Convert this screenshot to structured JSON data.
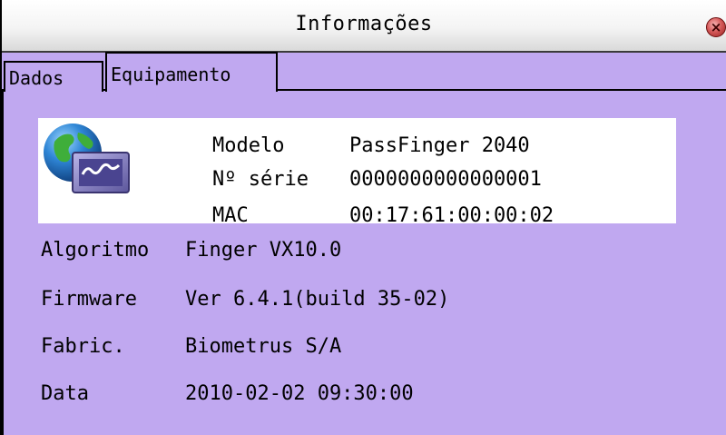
{
  "window": {
    "title": "Informações",
    "close_icon": "close-icon"
  },
  "tabs": [
    {
      "label": "Dados",
      "active": false
    },
    {
      "label": "Equipamento",
      "active": true
    }
  ],
  "device_info": {
    "icon": "network-device-icon",
    "rows": [
      {
        "label": "Modelo",
        "value": "PassFinger 2040"
      },
      {
        "label": "Nº série",
        "value": "0000000000000001"
      },
      {
        "label": "MAC",
        "value": "00:17:61:00:00:02"
      }
    ]
  },
  "details": [
    {
      "label": "Algoritmo",
      "value": "Finger VX10.0"
    },
    {
      "label": "Firmware",
      "value": "Ver 6.4.1(build 35-02)"
    },
    {
      "label": "Fabric.",
      "value": "Biometrus S/A"
    },
    {
      "label": "Data",
      "value": "2010-02-02 09:30:00"
    }
  ],
  "colors": {
    "panel_background": "#c0a8f0",
    "info_box_background": "#ffffff",
    "close_button": "#d65a5a"
  }
}
